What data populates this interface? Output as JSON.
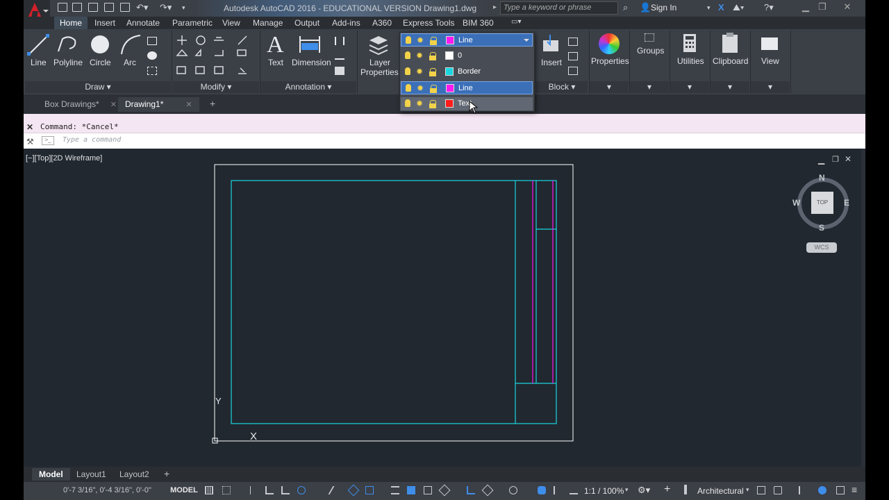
{
  "title_bar": {
    "title": "Autodesk AutoCAD 2016 - EDUCATIONAL VERSION    Drawing1.dwg",
    "search_placeholder": "Type a keyword or phrase",
    "sign_in": "Sign In"
  },
  "ribbon_tabs": [
    "Home",
    "Insert",
    "Annotate",
    "Parametric",
    "View",
    "Manage",
    "Output",
    "Add-ins",
    "A360",
    "Express Tools",
    "BIM 360"
  ],
  "ribbon": {
    "draw": {
      "line": "Line",
      "polyline": "Polyline",
      "circle": "Circle",
      "arc": "Arc",
      "panel": "Draw"
    },
    "modify": {
      "panel": "Modify"
    },
    "annotation": {
      "text": "Text",
      "dimension": "Dimension",
      "panel": "Annotation"
    },
    "layers": {
      "layer_properties_line1": "Layer",
      "layer_properties_line2": "Properties"
    },
    "block": {
      "insert": "Insert",
      "panel": "Block"
    },
    "properties": "Properties",
    "groups": "Groups",
    "utilities": "Utilities",
    "clipboard": "Clipboard",
    "view": "View"
  },
  "layer_dropdown": {
    "current": "Line",
    "layers": [
      {
        "name": "0",
        "color": "#ffffff"
      },
      {
        "name": "Border",
        "color": "#19d6e0"
      },
      {
        "name": "Line",
        "color": "#ff19f0"
      },
      {
        "name": "Text",
        "color": "#ff1b1b"
      }
    ],
    "current_color": "#ff19f0"
  },
  "file_tabs": [
    "Box Drawings*",
    "Drawing1*"
  ],
  "command_line": {
    "history": "Command: *Cancel*",
    "placeholder": "Type a command"
  },
  "viewport": {
    "label": "[−][Top][2D Wireframe]",
    "viewcube": {
      "n": "N",
      "s": "S",
      "e": "E",
      "w": "W",
      "top": "TOP",
      "wcs": "WCS"
    },
    "ucs_y": "Y",
    "ucs_x": "X"
  },
  "layout_tabs": [
    "Model",
    "Layout1",
    "Layout2"
  ],
  "status_bar": {
    "coordinates": "0'-7 3/16\", 0'-4 3/16\", 0'-0\"",
    "model": "MODEL",
    "scale": "1:1 / 100%",
    "units": "Architectural"
  },
  "colors": {
    "border": "#19d6e0",
    "line": "#ff19f0",
    "sheet": "#ffffff",
    "canvas": "#212830"
  }
}
